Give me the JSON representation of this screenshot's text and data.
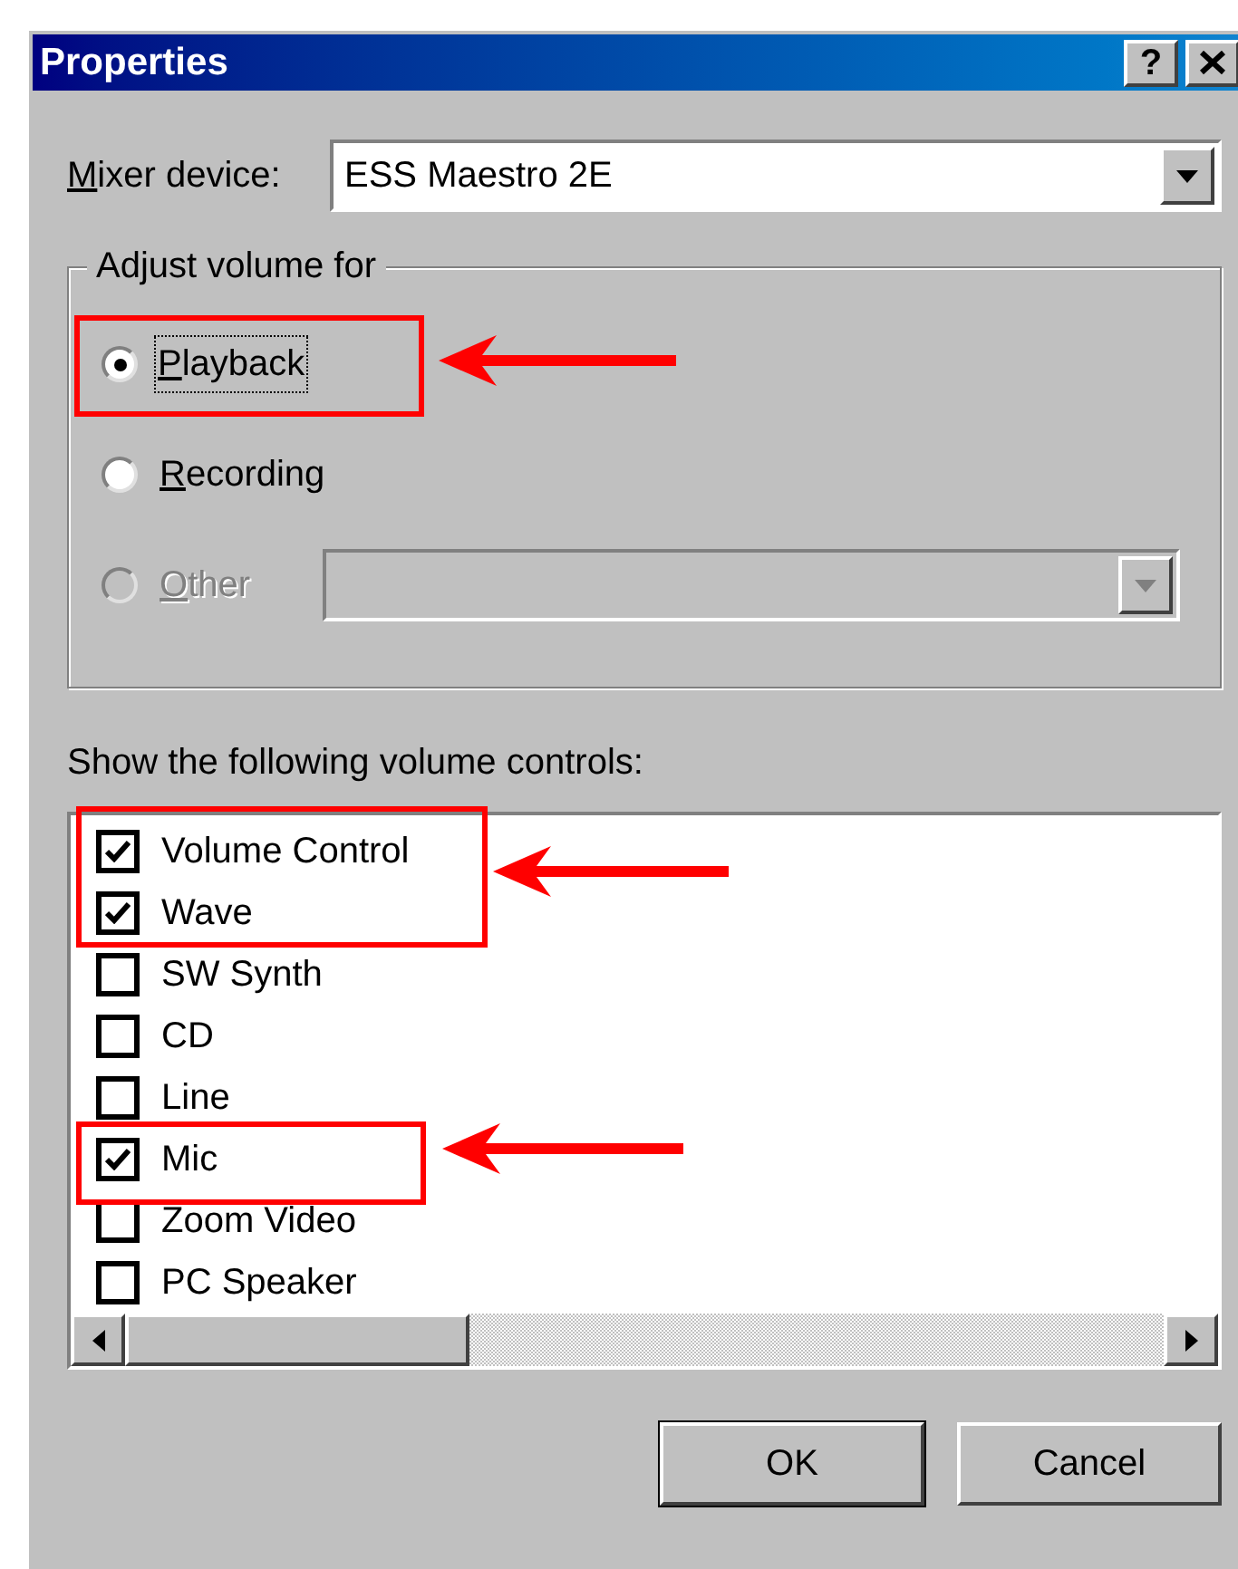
{
  "window": {
    "title": "Properties",
    "help_button": "?"
  },
  "mixer_device": {
    "label": "Mixer device:",
    "underline_first": true,
    "value": "ESS Maestro 2E"
  },
  "adjust_group": {
    "title": "Adjust volume for",
    "options": [
      {
        "label": "Playback",
        "selected": true,
        "disabled": false,
        "focused": true,
        "underline_first": true
      },
      {
        "label": "Recording",
        "selected": false,
        "disabled": false,
        "focused": false,
        "underline_first": true
      },
      {
        "label": "Other",
        "selected": false,
        "disabled": true,
        "focused": false,
        "underline_first": true,
        "has_combo": true
      }
    ]
  },
  "controls_label": "Show the following volume controls:",
  "controls": [
    {
      "label": "Volume Control",
      "checked": true
    },
    {
      "label": "Wave",
      "checked": true
    },
    {
      "label": "SW Synth",
      "checked": false
    },
    {
      "label": "CD",
      "checked": false
    },
    {
      "label": "Line",
      "checked": false
    },
    {
      "label": "Mic",
      "checked": true
    },
    {
      "label": "Zoom Video",
      "checked": false
    },
    {
      "label": "PC Speaker",
      "checked": false
    }
  ],
  "buttons": [
    {
      "label": "OK",
      "default": true
    },
    {
      "label": "Cancel",
      "default": false
    }
  ]
}
